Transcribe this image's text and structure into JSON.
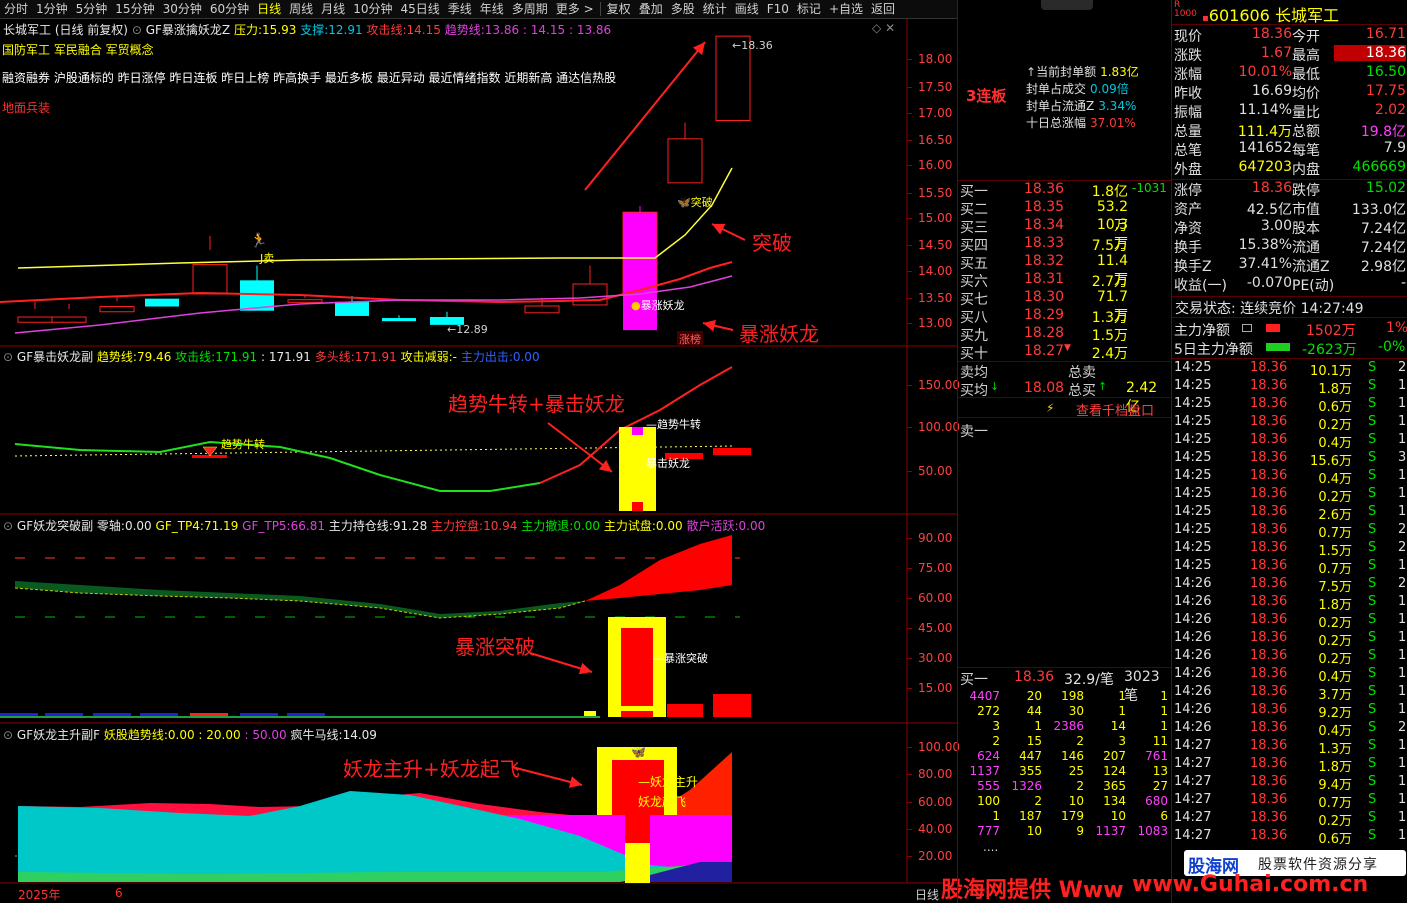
{
  "toolbar": {
    "periods": [
      "分时",
      "1分钟",
      "5分钟",
      "15分钟",
      "30分钟",
      "60分钟",
      "日线",
      "周线",
      "月线",
      "10分钟",
      "45日线",
      "季线",
      "年线",
      "多周期",
      "更多 >"
    ],
    "active": "日线",
    "tools": [
      "复权",
      "叠加",
      "多股",
      "统计",
      "画线",
      "F10",
      "标记",
      "+自选",
      "返回"
    ]
  },
  "panel1": {
    "title": "长城军工 (日线 前复权)",
    "indicator": "GF暴涨擒妖龙Z",
    "pressure_label": "压力:",
    "pressure": "15.93",
    "support_label": "支撑:",
    "support": "12.91",
    "attack_label": "攻击线:",
    "attack": "14.15",
    "trend_label": "趋势线:",
    "trend": "13.86",
    "extra1": ": 14.15",
    "extra2": ": 13.86",
    "concepts": "国防军工  军民融合  军贸概念",
    "tags": "融资融券  沪股通标的  昨日涨停  昨日连板  昨日上榜  昨高换手  最近多板  最近异动  最近情绪指数  近期新高  通达信热股",
    "sector": "地面兵装",
    "high_label": "18.36",
    "low_label": "12.89",
    "sign_sell": "J卖",
    "sign_break": "突破",
    "sign_dragon": "暴涨妖龙",
    "sign_board": "涨榜",
    "ann_break": "突破",
    "ann_dragon": "暴涨妖龙",
    "yaxis": [
      "18.00",
      "17.50",
      "17.00",
      "16.50",
      "16.00",
      "15.50",
      "15.00",
      "14.50",
      "14.00",
      "13.50",
      "13.00"
    ]
  },
  "panel2": {
    "title": "GF暴击妖龙副",
    "trend_label": "趋势线:",
    "trend": "79.46",
    "attack_label": "攻击线:",
    "attack": "171.91",
    "attack2": ": 171.91",
    "long_label": "多头线:",
    "long": "171.91",
    "weak_label": "攻击减弱:",
    "weak": "-",
    "main_label": "主力出击:",
    "main": "0.00",
    "sign1": "趋势牛转",
    "sign2": "趋势牛转",
    "sign3": "暴击妖龙",
    "ann": "趋势牛转+暴击妖龙",
    "yaxis": [
      "150.00",
      "100.00",
      "50.00"
    ]
  },
  "panel3": {
    "title": "GF妖龙突破副",
    "zero_label": "零轴:",
    "zero": "0.00",
    "tp4_label": "GF_TP4:",
    "tp4": "71.19",
    "tp5_label": "GF_TP5:",
    "tp5": "66.81",
    "hold_label": "主力持仓线:",
    "hold": "91.28",
    "ctrl_label": "主力控盘:",
    "ctrl": "10.94",
    "exit_label": "主力撤退:",
    "exit": "0.00",
    "test_label": "主力试盘:",
    "test": "0.00",
    "retail_label": "散户活跃:",
    "retail": "0.00",
    "sign": "暴涨突破",
    "ann": "暴涨突破",
    "yaxis": [
      "90.00",
      "75.00",
      "60.00",
      "45.00",
      "30.00",
      "15.00"
    ]
  },
  "panel4": {
    "title": "GF妖龙主升副F",
    "trend_label": "妖股趋势线:",
    "trend": "0.00",
    "v2": ": 20.00",
    "v3": ": 50.00",
    "bull_label": "疯牛马线:",
    "bull": "14.09",
    "sign1": "妖龙主升",
    "sign2": "妖龙起飞",
    "ann": "妖龙主升+妖龙起飞",
    "yaxis": [
      "100.00",
      "80.00",
      "60.00",
      "40.00",
      "20.00"
    ]
  },
  "xaxis": {
    "year": "2025年",
    "month": "6",
    "period": "日线"
  },
  "order": {
    "streak": "3连板",
    "seal": [
      {
        "label": "当前封单额",
        "value": "1.83亿"
      },
      {
        "label": "封单占成交",
        "value": "0.09倍"
      },
      {
        "label": "封单占流通Z",
        "value": "3.34%"
      },
      {
        "label": "十日总涨幅",
        "value": "37.01%"
      }
    ],
    "bids": [
      {
        "l": "买一",
        "p": "18.36",
        "v": "1.8亿",
        "c": "-1031"
      },
      {
        "l": "买二",
        "p": "18.35",
        "v": "53.2万",
        "c": ""
      },
      {
        "l": "买三",
        "p": "18.34",
        "v": "10.3万",
        "c": ""
      },
      {
        "l": "买四",
        "p": "18.33",
        "v": "7.5万",
        "c": ""
      },
      {
        "l": "买五",
        "p": "18.32",
        "v": "11.4万",
        "c": ""
      },
      {
        "l": "买六",
        "p": "18.31",
        "v": "2.7万",
        "c": ""
      },
      {
        "l": "买七",
        "p": "18.30",
        "v": "71.7万",
        "c": ""
      },
      {
        "l": "买八",
        "p": "18.29",
        "v": "1.3万",
        "c": ""
      },
      {
        "l": "买九",
        "p": "18.28",
        "v": "1.5万",
        "c": ""
      },
      {
        "l": "买十",
        "p": "18.27",
        "v": "2.4万",
        "c": ""
      }
    ],
    "sell_avg_label": "卖均",
    "buy_avg_label": "买均",
    "buy_avg": "18.08",
    "total_sell_label": "总卖",
    "total_buy_label": "总买",
    "total_buy": "2.42亿",
    "thousand_btn": "查看千档盘口",
    "sell1": "卖一",
    "queue_header": {
      "l": "买一",
      "p": "18.36",
      "per": "32.9/笔",
      "n": "3023笔"
    },
    "queue": [
      [
        "4407",
        "20",
        "198",
        "1",
        "1"
      ],
      [
        "272",
        "44",
        "30",
        "1",
        "1"
      ],
      [
        "3",
        "1",
        "2386",
        "14",
        "1"
      ],
      [
        "2",
        "15",
        "2",
        "3",
        "11"
      ],
      [
        "624",
        "447",
        "146",
        "207",
        "761"
      ],
      [
        "1137",
        "355",
        "25",
        "124",
        "13"
      ],
      [
        "555",
        "1326",
        "2",
        "365",
        "27"
      ],
      [
        "100",
        "2",
        "10",
        "134",
        "680"
      ],
      [
        "1",
        "187",
        "179",
        "10",
        "6"
      ],
      [
        "777",
        "10",
        "9",
        "1137",
        "1083"
      ]
    ],
    "more": "...."
  },
  "quote": {
    "code": "601606",
    "name": "长城军工",
    "r_badge": "R",
    "r_sub": "1000",
    "rows": [
      {
        "l1": "现价",
        "v1": "18.36",
        "l2": "今开",
        "v2": "16.71"
      },
      {
        "l1": "涨跌",
        "v1": "1.67",
        "l2": "最高",
        "v2": "18.36"
      },
      {
        "l1": "涨幅",
        "v1": "10.01%",
        "l2": "最低",
        "v2": "16.50"
      },
      {
        "l1": "昨收",
        "v1": "16.69",
        "l2": "均价",
        "v2": "17.75"
      },
      {
        "l1": "振幅",
        "v1": "11.14%",
        "l2": "量比",
        "v2": "2.02"
      },
      {
        "l1": "总量",
        "v1": "111.4万",
        "l2": "总额",
        "v2": "19.8亿"
      },
      {
        "l1": "总笔",
        "v1": "141652",
        "l2": "每笔",
        "v2": "7.9"
      },
      {
        "l1": "外盘",
        "v1": "647203",
        "l2": "内盘",
        "v2": "466669"
      }
    ],
    "rows2": [
      {
        "l1": "涨停",
        "v1": "18.36",
        "l2": "跌停",
        "v2": "15.02"
      },
      {
        "l1": "资产",
        "v1": "42.5亿",
        "l2": "市值",
        "v2": "133.0亿"
      },
      {
        "l1": "净资",
        "v1": "3.00",
        "l2": "股本",
        "v2": "7.24亿"
      },
      {
        "l1": "换手",
        "v1": "15.38%",
        "l2": "流通",
        "v2": "7.24亿"
      },
      {
        "l1": "换手Z",
        "v1": "37.41%",
        "l2": "流通Z",
        "v2": "2.98亿"
      },
      {
        "l1": "收益(一)",
        "v1": "-0.070",
        "l2": "PE(动)",
        "v2": "-"
      }
    ],
    "trade_state": "交易状态: 连续竞价 14:27:49",
    "main_net_label": "主力净额",
    "main_net": "1502万",
    "main_net_pct": "1%",
    "main5_label": "5日主力净额",
    "main5": "-2623万",
    "main5_pct": "-0%",
    "ticks": [
      [
        "14:25",
        "18.36",
        "10.1万",
        "S",
        "2"
      ],
      [
        "14:25",
        "18.36",
        "1.8万",
        "S",
        "1"
      ],
      [
        "14:25",
        "18.36",
        "0.6万",
        "S",
        "1"
      ],
      [
        "14:25",
        "18.36",
        "0.2万",
        "S",
        "1"
      ],
      [
        "14:25",
        "18.36",
        "0.4万",
        "S",
        "1"
      ],
      [
        "14:25",
        "18.36",
        "15.6万",
        "S",
        "3"
      ],
      [
        "14:25",
        "18.36",
        "0.4万",
        "S",
        "1"
      ],
      [
        "14:25",
        "18.36",
        "0.2万",
        "S",
        "1"
      ],
      [
        "14:25",
        "18.36",
        "2.6万",
        "S",
        "1"
      ],
      [
        "14:25",
        "18.36",
        "0.7万",
        "S",
        "2"
      ],
      [
        "14:25",
        "18.36",
        "1.5万",
        "S",
        "2"
      ],
      [
        "14:25",
        "18.36",
        "0.7万",
        "S",
        "1"
      ],
      [
        "14:26",
        "18.36",
        "7.5万",
        "S",
        "2"
      ],
      [
        "14:26",
        "18.36",
        "1.8万",
        "S",
        "1"
      ],
      [
        "14:26",
        "18.36",
        "0.2万",
        "S",
        "1"
      ],
      [
        "14:26",
        "18.36",
        "0.2万",
        "S",
        "1"
      ],
      [
        "14:26",
        "18.36",
        "0.2万",
        "S",
        "1"
      ],
      [
        "14:26",
        "18.36",
        "0.4万",
        "S",
        "1"
      ],
      [
        "14:26",
        "18.36",
        "3.7万",
        "S",
        "1"
      ],
      [
        "14:26",
        "18.36",
        "9.2万",
        "S",
        "1"
      ],
      [
        "14:26",
        "18.36",
        "0.4万",
        "S",
        "2"
      ],
      [
        "14:27",
        "18.36",
        "1.3万",
        "S",
        "1"
      ],
      [
        "14:27",
        "18.36",
        "1.8万",
        "S",
        "1"
      ],
      [
        "14:27",
        "18.36",
        "9.4万",
        "S",
        "1"
      ],
      [
        "14:27",
        "18.36",
        "0.7万",
        "S",
        "1"
      ],
      [
        "14:27",
        "18.36",
        "0.2万",
        "S",
        "1"
      ],
      [
        "14:27",
        "18.36",
        "0.6万",
        "S",
        "1"
      ]
    ]
  },
  "watermark": {
    "logo1": "股海网",
    "logo2": "股票软件资源分享",
    "url": "www.Guhai.com.cn",
    "footer": "股海网提供 Www"
  },
  "colors": {
    "up": "#ff3b3b",
    "down": "#00ffff",
    "bg": "#000000",
    "yellow": "#ffff00",
    "magenta": "#ff00ff"
  }
}
